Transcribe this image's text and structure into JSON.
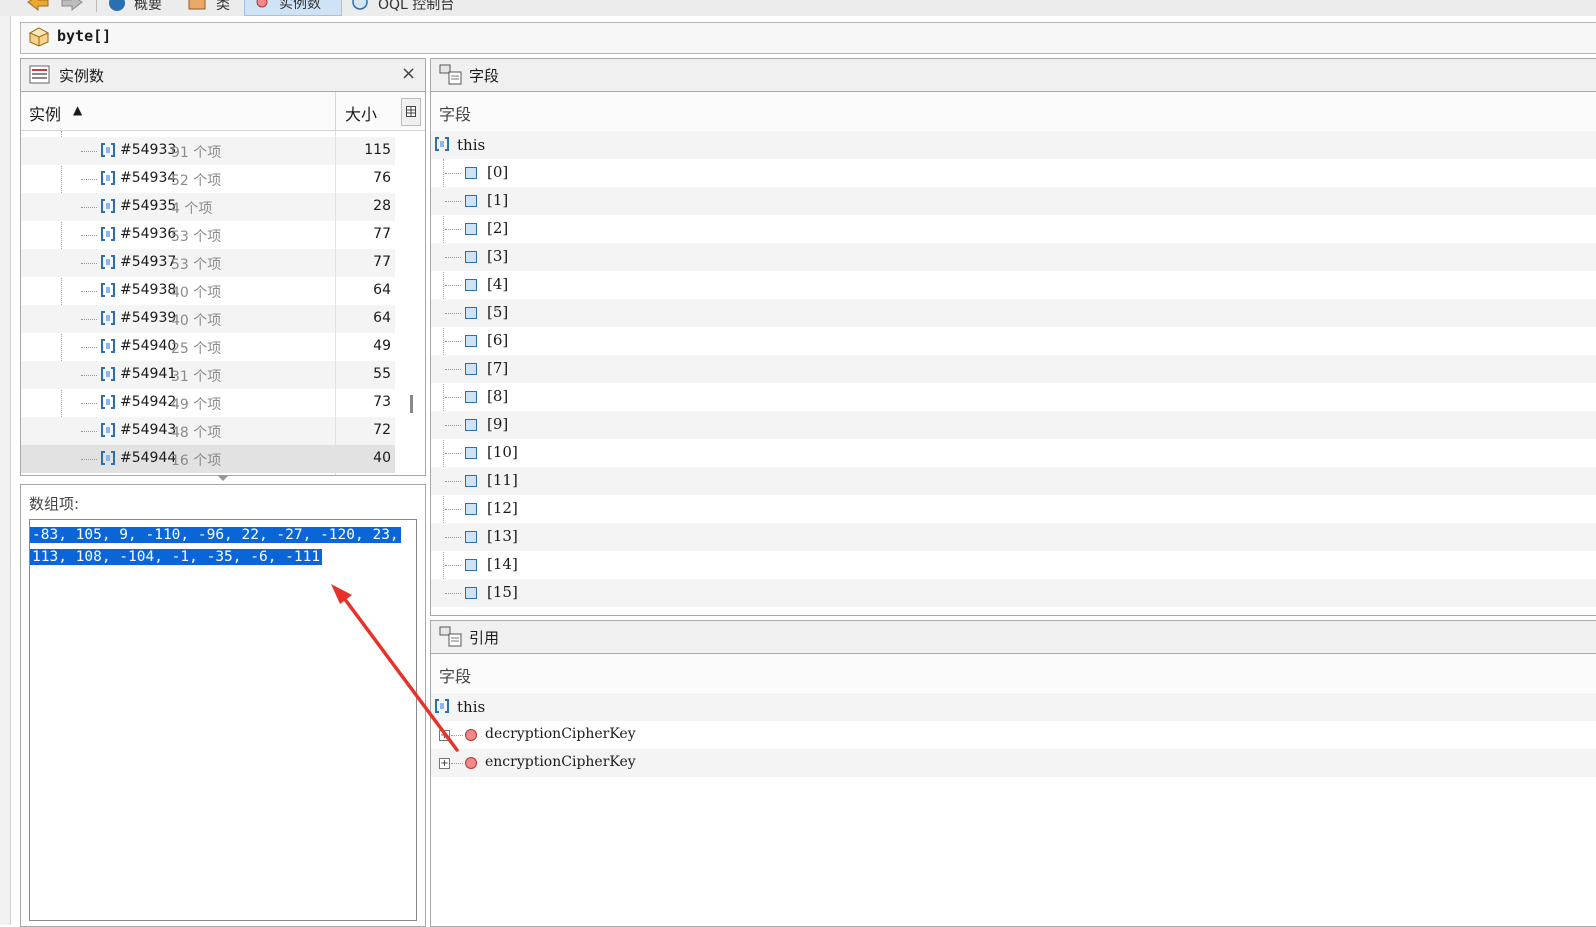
{
  "nav": {
    "summary": "概要",
    "classes": "类",
    "instances": "实例数",
    "oql": "OQL 控制台"
  },
  "class_name": "byte[]",
  "instances_panel": {
    "title": "实例数",
    "close": "×",
    "col_instance": "实例",
    "sort_indicator": "▲",
    "col_size": "大小",
    "rows": [
      {
        "id": "#54933",
        "items": "91  个项",
        "size": "115"
      },
      {
        "id": "#54934",
        "items": "52  个项",
        "size": "76"
      },
      {
        "id": "#54935",
        "items": "4  个项",
        "size": "28"
      },
      {
        "id": "#54936",
        "items": "53  个项",
        "size": "77"
      },
      {
        "id": "#54937",
        "items": "53  个项",
        "size": "77"
      },
      {
        "id": "#54938",
        "items": "40  个项",
        "size": "64"
      },
      {
        "id": "#54939",
        "items": "40  个项",
        "size": "64"
      },
      {
        "id": "#54940",
        "items": "25  个项",
        "size": "49"
      },
      {
        "id": "#54941",
        "items": "31  个项",
        "size": "55"
      },
      {
        "id": "#54942",
        "items": "49  个项",
        "size": "73"
      },
      {
        "id": "#54943",
        "items": "48  个项",
        "size": "72"
      },
      {
        "id": "#54944",
        "items": "16  个项",
        "size": "40"
      }
    ]
  },
  "array_panel": {
    "label": "数组项:",
    "line1": "-83, 105, 9, -110, -96, 22, -27, -120, 23,",
    "line2": "113, 108, -104, -1, -35, -6, -111"
  },
  "fields_panel": {
    "title": "字段",
    "col": "字段",
    "root": "this",
    "items": [
      "[0]",
      "[1]",
      "[2]",
      "[3]",
      "[4]",
      "[5]",
      "[6]",
      "[7]",
      "[8]",
      "[9]",
      "[10]",
      "[11]",
      "[12]",
      "[13]",
      "[14]",
      "[15]"
    ]
  },
  "refs_panel": {
    "title": "引用",
    "col": "字段",
    "root": "this",
    "items": [
      "decryptionCipherKey",
      "encryptionCipherKey"
    ]
  },
  "colors": {
    "selection": "#0a66d8",
    "annotation_arrow": "#e8312a",
    "icon_blue": "#2a6fb0"
  }
}
